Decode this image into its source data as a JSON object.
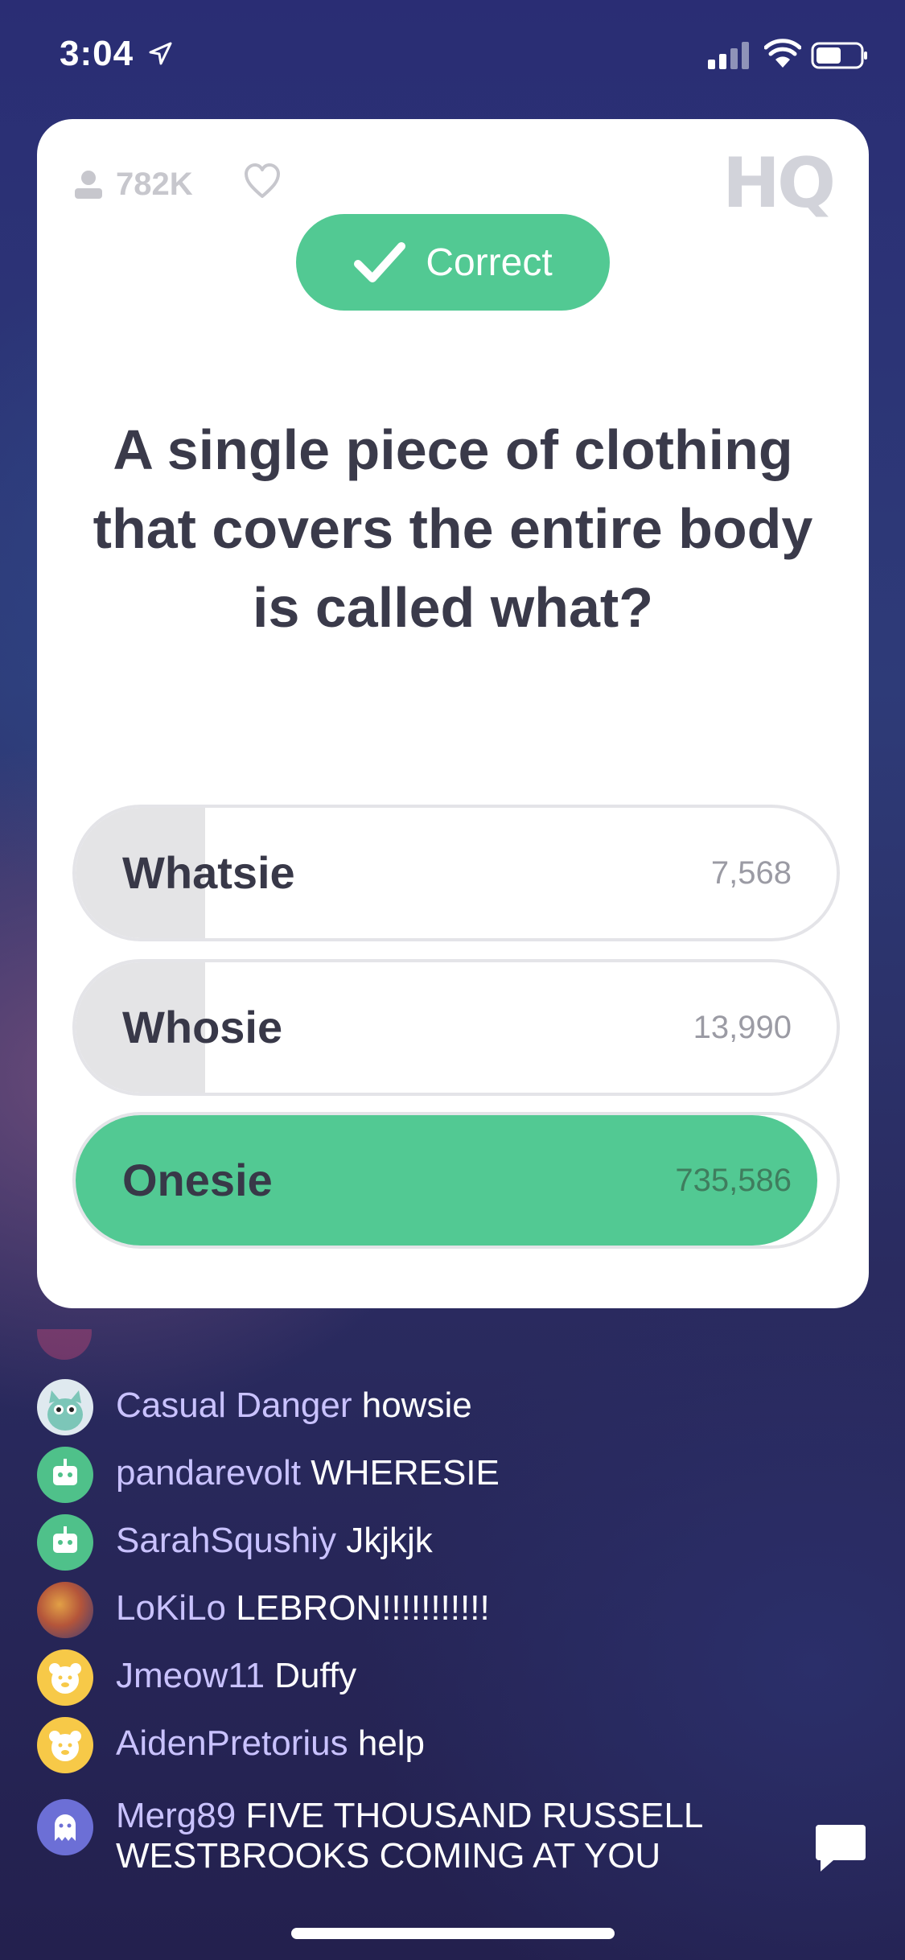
{
  "status_bar": {
    "time": "3:04",
    "icons": [
      "location-arrow-icon",
      "cellular-signal-icon",
      "wifi-icon",
      "battery-icon"
    ]
  },
  "game": {
    "viewer_count": "782K",
    "logo": "HQ",
    "result_label": "Correct",
    "question": "A single piece of clothing that covers the entire body is called what?",
    "answers": [
      {
        "text": "Whatsie",
        "votes": "7,568",
        "fill_fraction": 0.17,
        "correct": false
      },
      {
        "text": "Whosie",
        "votes": "13,990",
        "fill_fraction": 0.17,
        "correct": false
      },
      {
        "text": "Onesie",
        "votes": "735,586",
        "fill_fraction": 0.975,
        "correct": true
      }
    ],
    "colors": {
      "correct": "#52c993",
      "card": "#ffffff",
      "text": "#3a3a4a"
    }
  },
  "chat": {
    "messages": [
      {
        "user": "Casual Danger",
        "text": "howsie",
        "avatar": "cat-avatar"
      },
      {
        "user": "pandarevolt",
        "text": "WHERESIE",
        "avatar": "robot-avatar"
      },
      {
        "user": "SarahSqushiy",
        "text": "Jkjkjk",
        "avatar": "robot-avatar"
      },
      {
        "user": "LoKiLo",
        "text": "LEBRON!!!!!!!!!!!",
        "avatar": "lion-avatar"
      },
      {
        "user": "Jmeow11",
        "text": "Duffy",
        "avatar": "bear-avatar"
      },
      {
        "user": "AidenPretorius",
        "text": "help",
        "avatar": "bear-avatar"
      },
      {
        "user": "Merg89",
        "text": "FIVE THOUSAND RUSSELL WESTBROOKS COMING AT YOU",
        "avatar": "ghost-avatar"
      }
    ]
  }
}
